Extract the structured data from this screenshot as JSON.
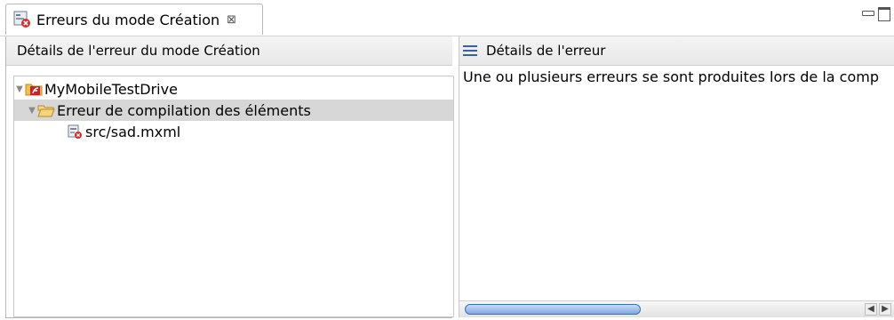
{
  "tab": {
    "title": "Erreurs du mode Création",
    "close_glyph": "⊠",
    "icon": "error-view-icon"
  },
  "left_panel": {
    "header": "Détails de l'erreur du mode Création",
    "tree": [
      {
        "label": "MyMobileTestDrive",
        "icon": "flex-project-folder-icon",
        "expanded": true
      },
      {
        "label": "Erreur de compilation des éléments",
        "icon": "open-folder-icon",
        "expanded": true,
        "selected": true
      },
      {
        "label": "src/sad.mxml",
        "icon": "mxml-error-file-icon"
      }
    ]
  },
  "right_panel": {
    "header": "Détails de l'erreur",
    "icon": "menu-lines-icon",
    "text": "Une ou plusieurs erreurs se sont produites lors de la comp"
  },
  "colors": {
    "selection": "#d7d7d7",
    "accent": "#3b6fb8",
    "error_red": "#d62b2b"
  }
}
